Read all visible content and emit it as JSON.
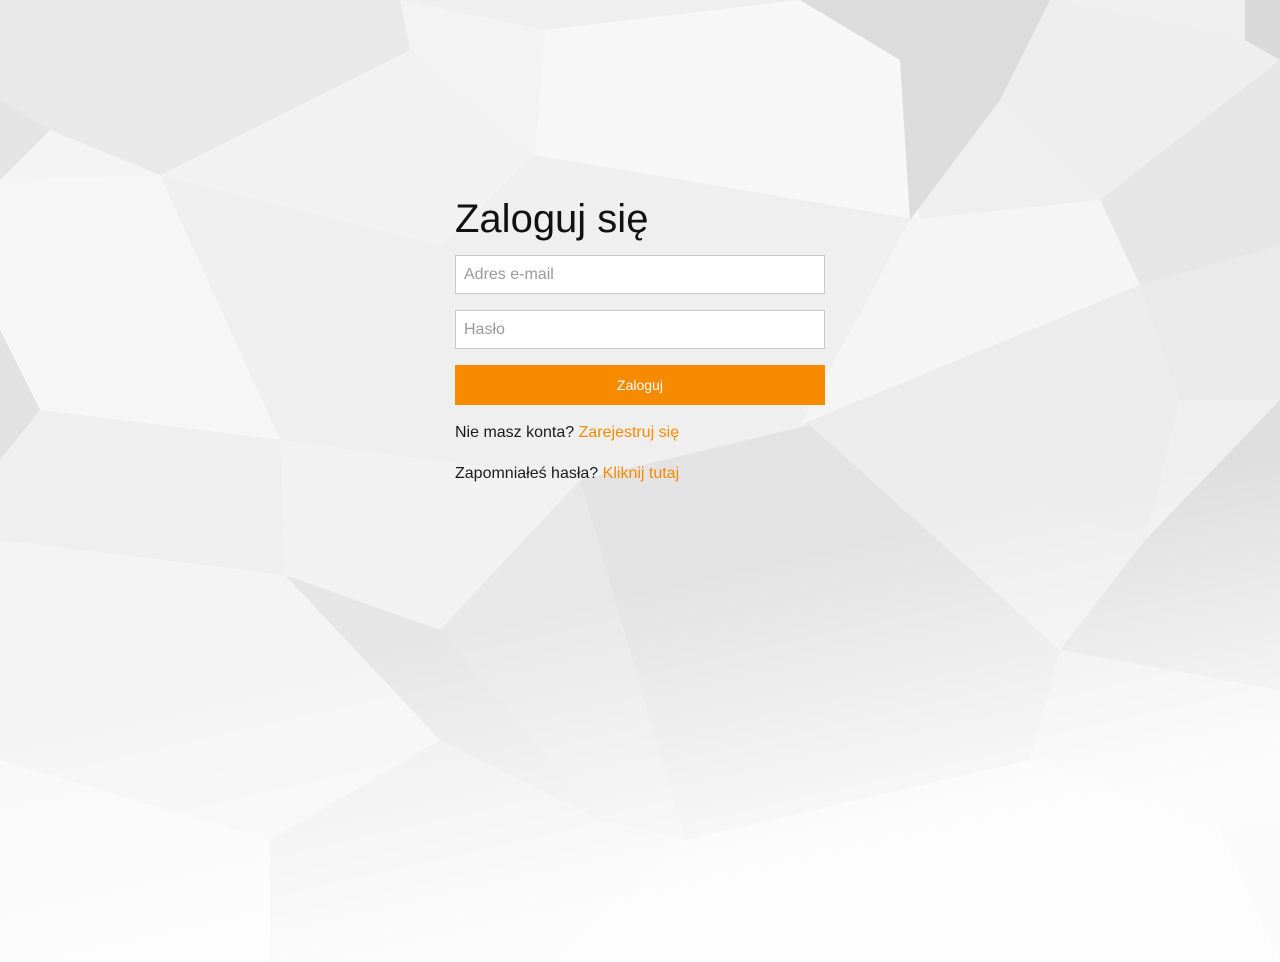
{
  "login": {
    "title": "Zaloguj się",
    "email_placeholder": "Adres e-mail",
    "password_placeholder": "Hasło",
    "submit_label": "Zaloguj",
    "register_prompt": "Nie masz konta?",
    "register_link": "Zarejestruj się",
    "forgot_prompt": "Zapomniałeś hasła?",
    "forgot_link": "Kliknij tutaj"
  },
  "colors": {
    "accent": "#f68b00",
    "background": "#f1f1f1",
    "text": "#1a1a1a"
  }
}
